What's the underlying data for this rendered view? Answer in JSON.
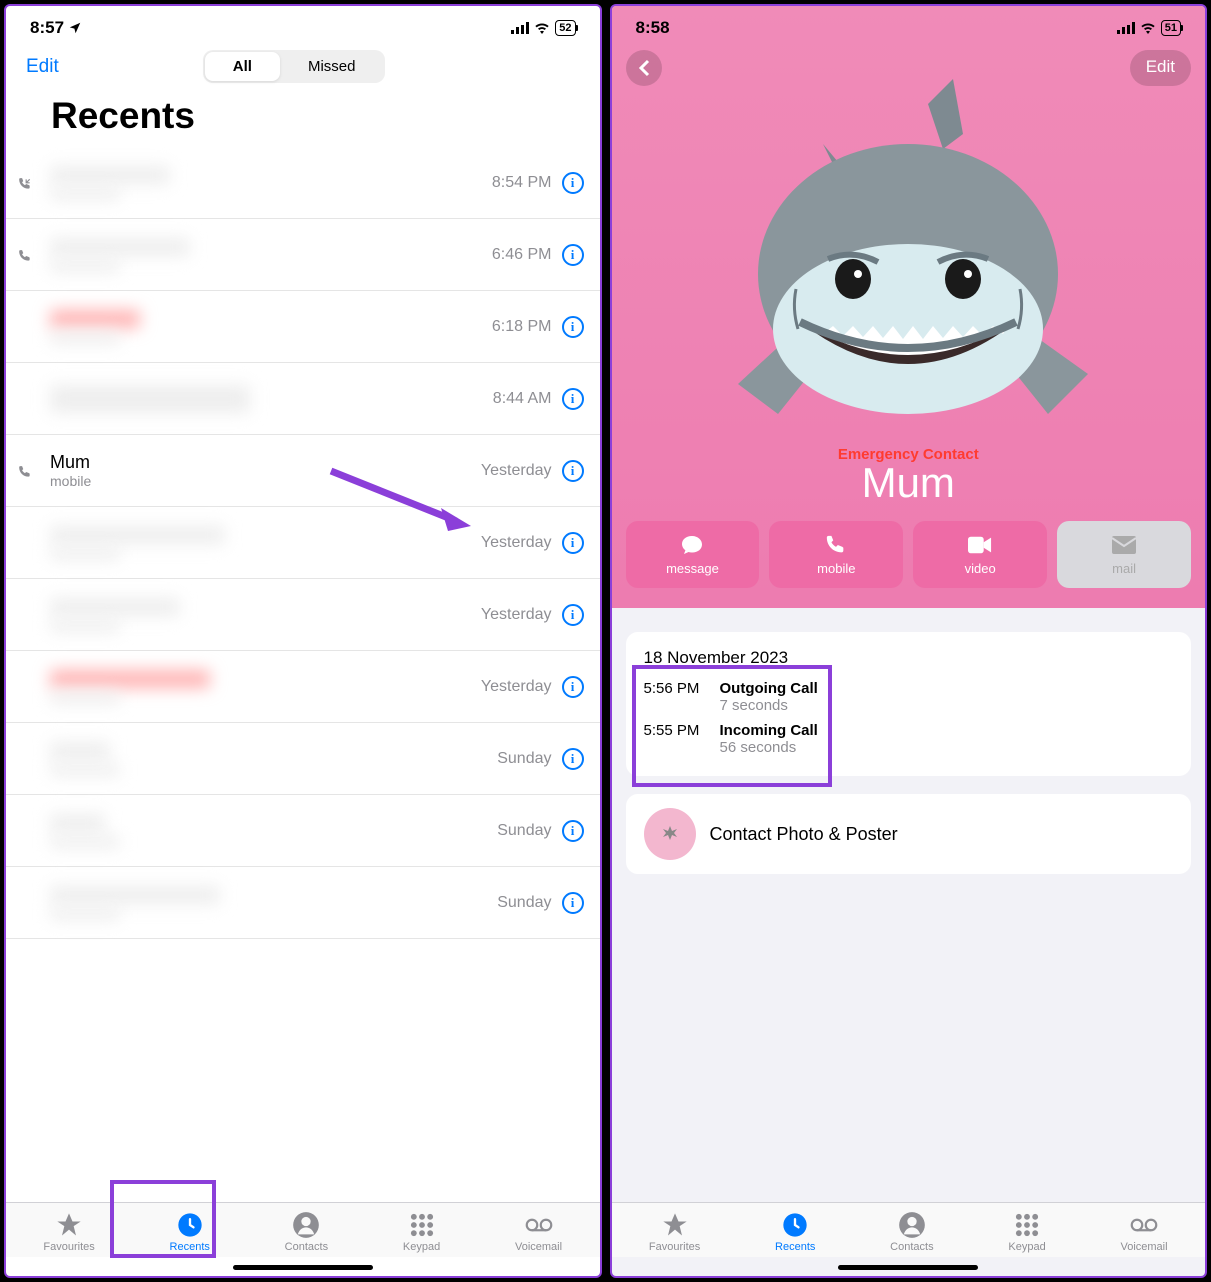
{
  "left": {
    "status": {
      "time": "8:57",
      "battery": "52"
    },
    "edit": "Edit",
    "segment": {
      "all": "All",
      "missed": "Missed"
    },
    "title": "Recents",
    "calls": [
      {
        "time": "8:54 PM",
        "missed": false,
        "incoming": true
      },
      {
        "time": "6:46 PM",
        "missed": false,
        "incoming": true
      },
      {
        "time": "6:18 PM",
        "missed": true,
        "incoming": false
      },
      {
        "time": "8:44 AM",
        "missed": false,
        "incoming": false
      },
      {
        "name": "Mum",
        "sub": "mobile",
        "time": "Yesterday",
        "missed": false,
        "incoming": true
      },
      {
        "time": "Yesterday",
        "missed": false
      },
      {
        "time": "Yesterday",
        "missed": false
      },
      {
        "time": "Yesterday",
        "missed": true
      },
      {
        "time": "Sunday",
        "missed": false
      },
      {
        "time": "Sunday",
        "missed": false
      },
      {
        "time": "Sunday",
        "missed": false
      }
    ],
    "tabs": {
      "favourites": "Favourites",
      "recents": "Recents",
      "contacts": "Contacts",
      "keypad": "Keypad",
      "voicemail": "Voicemail"
    }
  },
  "right": {
    "status": {
      "time": "8:58",
      "battery": "51"
    },
    "edit": "Edit",
    "emergency": "Emergency Contact",
    "name": "Mum",
    "actions": {
      "message": "message",
      "mobile": "mobile",
      "video": "video",
      "mail": "mail"
    },
    "history": {
      "date": "18 November 2023",
      "entries": [
        {
          "time": "5:56 PM",
          "type": "Outgoing Call",
          "duration": "7 seconds"
        },
        {
          "time": "5:55 PM",
          "type": "Incoming Call",
          "duration": "56 seconds"
        }
      ]
    },
    "poster": "Contact Photo & Poster",
    "tabs": {
      "favourites": "Favourites",
      "recents": "Recents",
      "contacts": "Contacts",
      "keypad": "Keypad",
      "voicemail": "Voicemail"
    }
  }
}
